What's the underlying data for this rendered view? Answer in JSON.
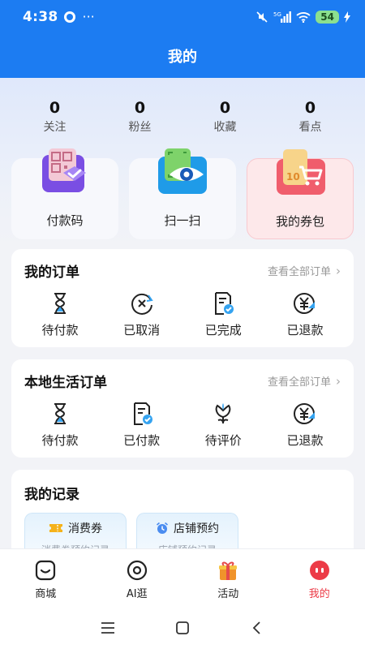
{
  "status_bar": {
    "time": "4:38",
    "dots": "···",
    "network": "5G",
    "battery": "54"
  },
  "header": {
    "title": "我的"
  },
  "stats": [
    {
      "value": "0",
      "label": "关注"
    },
    {
      "value": "0",
      "label": "粉丝"
    },
    {
      "value": "0",
      "label": "收藏"
    },
    {
      "value": "0",
      "label": "看点"
    }
  ],
  "quick_actions": [
    {
      "label": "付款码",
      "icon": "qr-code-icon"
    },
    {
      "label": "扫一扫",
      "icon": "scan-eye-icon"
    },
    {
      "label": "我的券包",
      "icon": "coupon-cart-icon"
    }
  ],
  "my_orders": {
    "title": "我的订单",
    "link": "查看全部订单",
    "items": [
      {
        "label": "待付款",
        "icon": "hourglass-icon"
      },
      {
        "label": "已取消",
        "icon": "cancel-clock-icon"
      },
      {
        "label": "已完成",
        "icon": "document-check-icon"
      },
      {
        "label": "已退款",
        "icon": "yen-refund-icon"
      }
    ]
  },
  "local_orders": {
    "title": "本地生活订单",
    "link": "查看全部订单",
    "items": [
      {
        "label": "待付款",
        "icon": "hourglass-icon"
      },
      {
        "label": "已付款",
        "icon": "document-check-icon"
      },
      {
        "label": "待评价",
        "icon": "flower-icon"
      },
      {
        "label": "已退款",
        "icon": "yen-refund-icon"
      }
    ]
  },
  "records": {
    "title": "我的记录",
    "items": [
      {
        "label": "消费券",
        "sub": "消费券预约记录",
        "icon": "ticket-icon"
      },
      {
        "label": "店铺预约",
        "sub": "店铺预约记录",
        "icon": "alarm-clock-icon"
      }
    ]
  },
  "tabbar": [
    {
      "label": "商城",
      "icon": "mall-icon",
      "active": false
    },
    {
      "label": "AI逛",
      "icon": "ai-browse-icon",
      "active": false
    },
    {
      "label": "活动",
      "icon": "gift-icon",
      "active": false
    },
    {
      "label": "我的",
      "icon": "profile-icon",
      "active": true
    }
  ],
  "colors": {
    "brand": "#1c7cf2",
    "accent": "#ec3b47",
    "background": "#f2f3f7"
  }
}
